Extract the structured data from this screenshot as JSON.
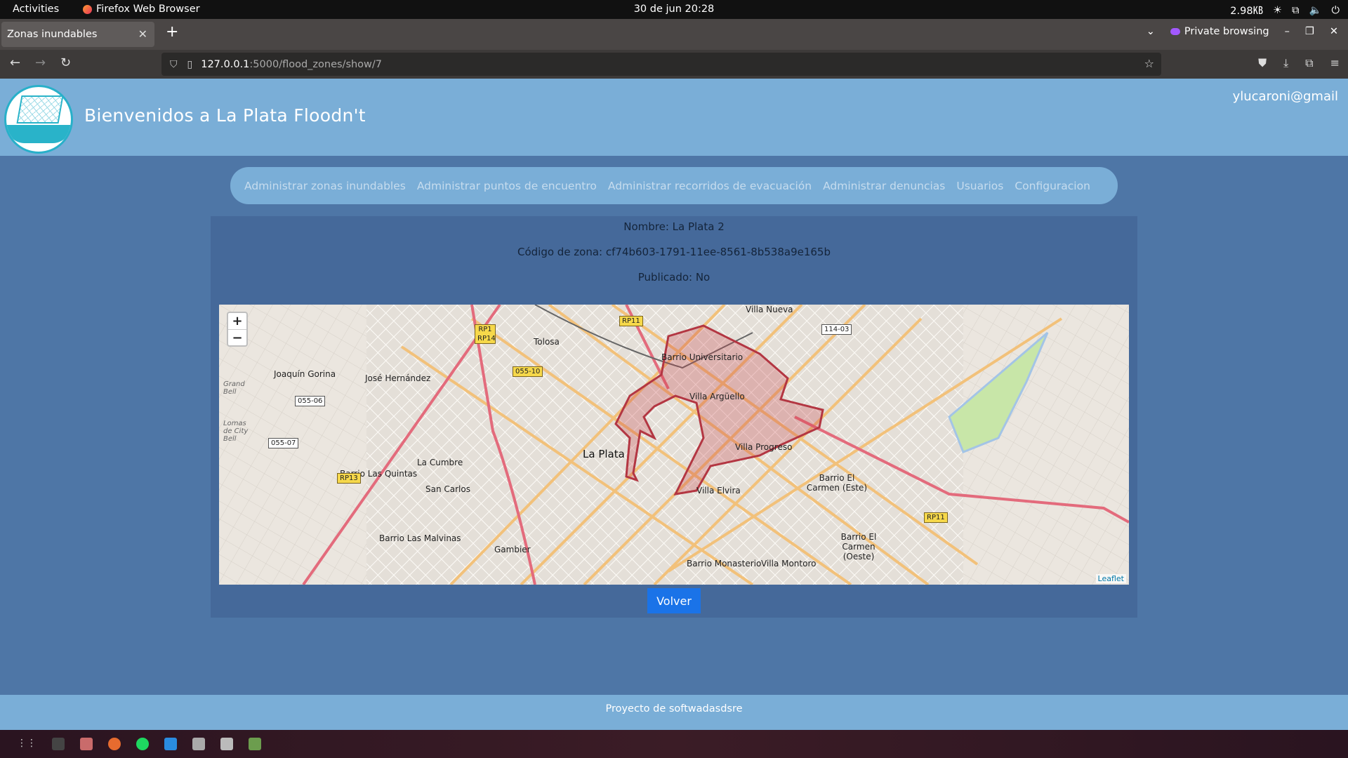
{
  "system": {
    "activities": "Activities",
    "app_name": "Firefox Web Browser",
    "clock": "30 de jun  20:28",
    "tray_text": "2.98㎅"
  },
  "browser": {
    "tab_title": "Zonas inundables",
    "new_tab": "+",
    "private_label": "Private browsing",
    "url_host": "127.0.0.1",
    "url_path": ":5000/flood_zones/show/7"
  },
  "header": {
    "title": "Bienvenidos a La Plata Floodn't",
    "user": "ylucaroni@gmail"
  },
  "menu": {
    "items": [
      "Administrar zonas inundables",
      "Administrar puntos de encuentro",
      "Administrar recorridos de evacuación",
      "Administrar denuncias",
      "Usuarios",
      "Configuracion"
    ]
  },
  "zone": {
    "name_line": "Nombre: La Plata 2",
    "code_line": "Código de zona: cf74b603-1791-11ee-8561-8b538a9e165b",
    "published_line": "Publicado: No"
  },
  "map": {
    "zoom_in": "+",
    "zoom_out": "−",
    "attribution": "Leaflet",
    "labels": {
      "villa_nueva": "Villa Nueva",
      "tolosa": "Tolosa",
      "joaquin_gorina": "Joaquín Gorina",
      "jose_hernandez": "José Hernández",
      "barrio_universitario": "Barrio Universitario",
      "villa_arguello": "Villa Argüello",
      "la_plata": "La Plata",
      "villa_progreso": "Villa Progreso",
      "la_cumbre": "La Cumbre",
      "barrio_las_quintas": "Barrio Las Quintas",
      "san_carlos": "San Carlos",
      "villa_elvira": "Villa Elvira",
      "barrio_el_carmen_este": "Barrio El Carmen (Este)",
      "barrio_el_carmen_oeste": "Barrio El Carmen (Oeste)",
      "barrio_las_malvinas": "Barrio Las Malvinas",
      "gambier": "Gambier",
      "barrio_monasterio": "Barrio Monasterio",
      "villa_montoro": "Villa Montoro",
      "grand_bell": "Grand Bell",
      "lomas_city_bell": "Lomas de City Bell"
    },
    "shields": {
      "rp1": "RP1 RP14",
      "rp11_top": "RP11",
      "r114": "114-03",
      "r05510": "055-10",
      "r05506": "055-06",
      "r05507": "055-07",
      "rp13": "RP13",
      "rp11_bottom": "RP11"
    }
  },
  "actions": {
    "back_button": "Volver"
  },
  "footer": {
    "text": "Proyecto de softwadasdsre"
  }
}
